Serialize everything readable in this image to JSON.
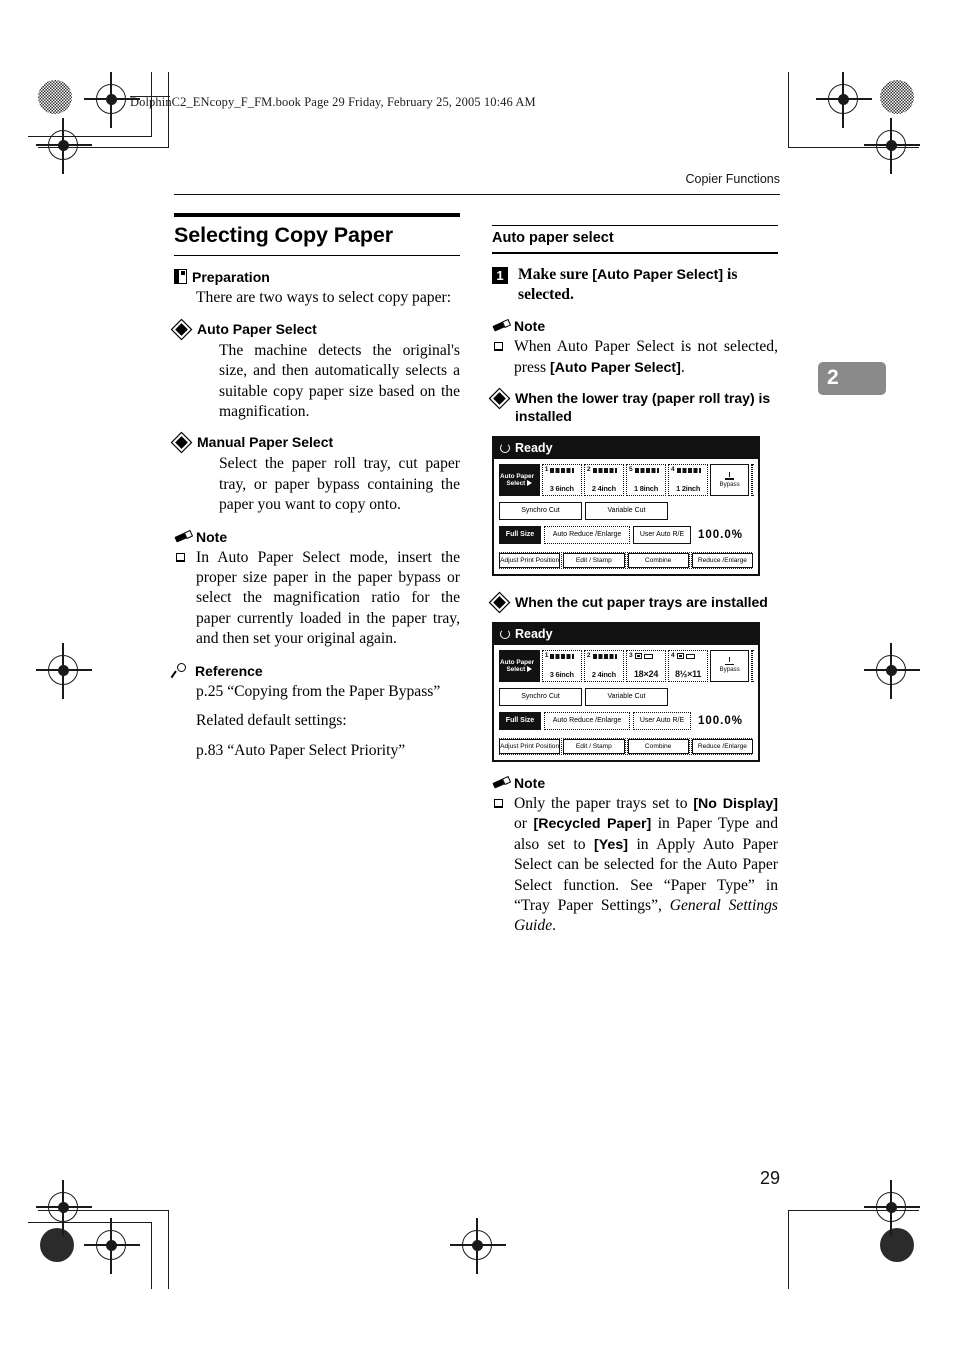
{
  "file_header": {
    "text": "DolphinC2_ENcopy_F_FM.book  Page 29  Friday, February 25, 2005  10:46 AM"
  },
  "running_head": "Copier Functions",
  "chapter_tab": "2",
  "folio": "29",
  "left_column": {
    "section_title": "Selecting Copy Paper",
    "preparation": {
      "label": "Preparation",
      "text": "There are two ways to select copy paper:",
      "items": [
        {
          "title": "Auto Paper Select",
          "text": "The machine detects the original's size, and then automatically selects a suitable copy paper size based on the magnification."
        },
        {
          "title": "Manual Paper Select",
          "text": "Select the paper roll tray, cut paper tray, or paper bypass containing the paper you want to copy onto."
        }
      ]
    },
    "note": {
      "label": "Note",
      "items": [
        "In Auto Paper Select mode, insert the proper size paper in the paper bypass or select the magnification ratio for the paper currently loaded in the paper tray, and then set your original again."
      ]
    },
    "reference": {
      "label": "Reference",
      "lines": [
        "p.25 “Copying from the Paper Bypass”",
        "Related default settings:",
        "p.83 “Auto Paper Select Priority”"
      ]
    }
  },
  "right_column": {
    "sub_title": "Auto paper select",
    "step": {
      "number": "1",
      "text_a": "Make sure ",
      "text_b": "[Auto Paper Select]",
      "text_c": " is selected."
    },
    "note_top": {
      "label": "Note",
      "item_a": "When Auto Paper Select is not selected, press ",
      "item_b": "[Auto Paper Select]",
      "item_c": "."
    },
    "figure_1": {
      "caption": "When the lower tray (paper roll tray) is installed",
      "panel": {
        "status": "Ready",
        "auto_paper_select": "Auto Paper Select",
        "trays": [
          {
            "num": "1",
            "type": "roll",
            "size": "3 6inch"
          },
          {
            "num": "2",
            "type": "roll",
            "size": "2 4inch"
          },
          {
            "num": "5",
            "type": "roll",
            "size": "1 8inch"
          },
          {
            "num": "4",
            "type": "roll",
            "size": "1 2inch"
          }
        ],
        "bypass": "Bypass",
        "cut_buttons": [
          "Synchro Cut",
          "Variable Cut"
        ],
        "mag_buttons": [
          "Full Size",
          "Auto Reduce /Enlarge",
          "User Auto R/E"
        ],
        "mag_value": "100.0%",
        "function_buttons": [
          "Adjust Print Position",
          "Edit / Stamp",
          "Combine",
          "Reduce /Enlarge"
        ]
      }
    },
    "figure_2": {
      "caption": "When the cut paper trays are installed",
      "panel": {
        "status": "Ready",
        "auto_paper_select": "Auto Paper Select",
        "trays": [
          {
            "num": "1",
            "type": "roll",
            "size": "3 6inch"
          },
          {
            "num": "2",
            "type": "roll",
            "size": "2 4inch"
          },
          {
            "num": "3",
            "type": "sheet",
            "size": "18×24"
          },
          {
            "num": "4",
            "type": "sheet",
            "size": "8½×11"
          }
        ],
        "bypass": "Bypass",
        "cut_buttons": [
          "Synchro Cut",
          "Variable Cut"
        ],
        "mag_buttons": [
          "Full Size",
          "Auto Reduce /Enlarge",
          "User Auto R/E"
        ],
        "mag_value": "100.0%",
        "function_buttons": [
          "Adjust Print Position",
          "Edit / Stamp",
          "Combine",
          "Reduce /Enlarge"
        ]
      }
    },
    "note_bottom": {
      "label": "Note",
      "p1": "Only the paper trays set to ",
      "b1": "[No Display]",
      "p2": " or ",
      "b2": "[Recycled Paper]",
      "p3": " in Paper Type and also set to ",
      "b3": "[Yes]",
      "p4": " in Apply Auto Paper Select can be selected for the Auto Paper Select function. See “Paper Type” in “Tray Paper Settings”, ",
      "i1": "General Settings Guide",
      "p5": "."
    }
  }
}
